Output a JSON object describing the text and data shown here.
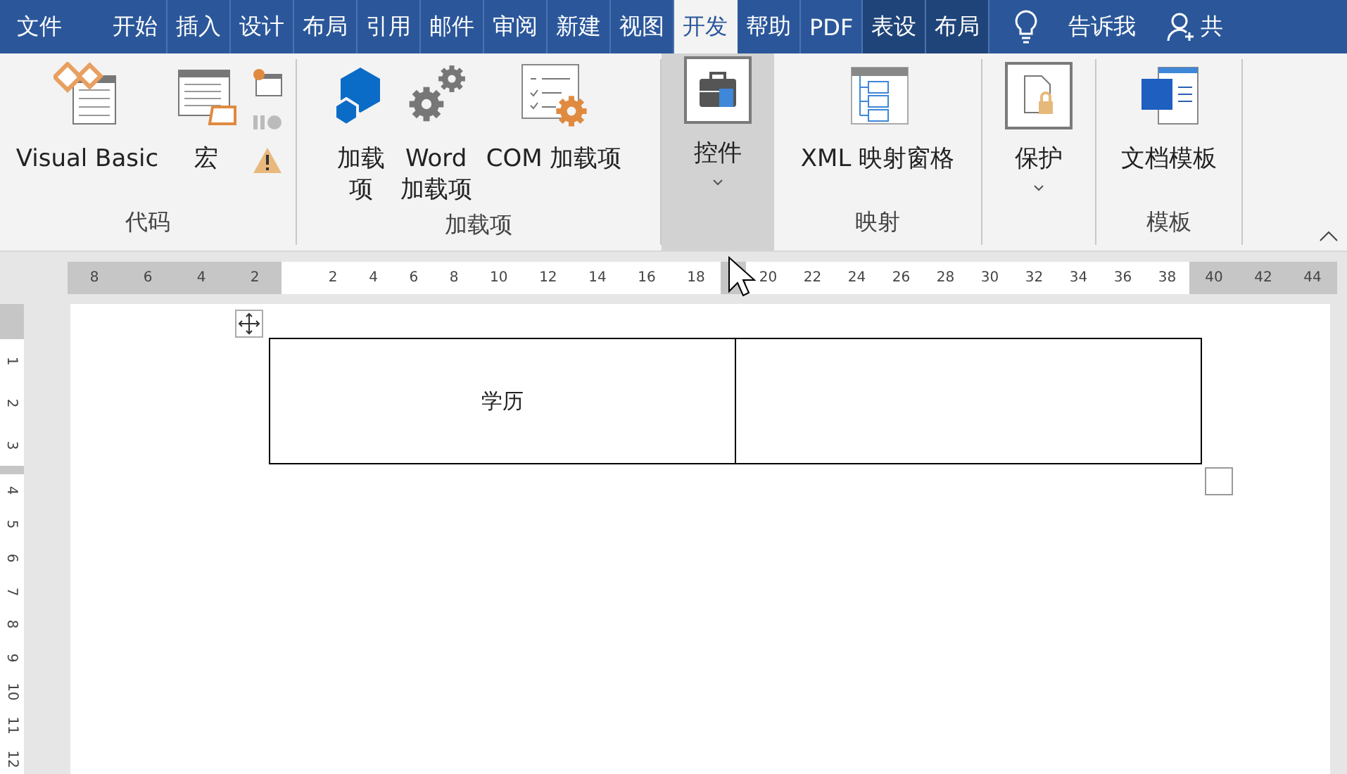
{
  "tabs": [
    {
      "label": "文件",
      "selected": false,
      "kind": "file"
    },
    {
      "label": "开始",
      "selected": false,
      "kind": "normal"
    },
    {
      "label": "插入",
      "selected": false,
      "kind": "normal"
    },
    {
      "label": "设计",
      "selected": false,
      "kind": "normal"
    },
    {
      "label": "布局",
      "selected": false,
      "kind": "normal"
    },
    {
      "label": "引用",
      "selected": false,
      "kind": "normal"
    },
    {
      "label": "邮件",
      "selected": false,
      "kind": "normal"
    },
    {
      "label": "审阅",
      "selected": false,
      "kind": "normal"
    },
    {
      "label": "新建",
      "selected": false,
      "kind": "normal"
    },
    {
      "label": "视图",
      "selected": false,
      "kind": "normal"
    },
    {
      "label": "开发",
      "selected": true,
      "kind": "normal"
    },
    {
      "label": "帮助",
      "selected": false,
      "kind": "normal"
    },
    {
      "label": "PDF",
      "selected": false,
      "kind": "normal"
    },
    {
      "label": "表设",
      "selected": false,
      "kind": "contextual"
    },
    {
      "label": "布局",
      "selected": false,
      "kind": "contextual"
    }
  ],
  "tell_me": "告诉我",
  "share": "共",
  "groups": [
    {
      "label": "代码",
      "buttons": [
        {
          "kind": "large",
          "label": "Visual Basic"
        },
        {
          "kind": "large",
          "label": "宏"
        },
        {
          "kind": "small_stack"
        }
      ]
    },
    {
      "label": "加载项",
      "buttons": [
        {
          "kind": "narrow",
          "label": "加载项"
        },
        {
          "kind": "large",
          "label": "Word\n加载项"
        },
        {
          "kind": "large",
          "label": "COM 加载项"
        }
      ]
    },
    {
      "pressed": true,
      "buttons": [
        {
          "kind": "dropdown",
          "label": "控件"
        }
      ]
    },
    {
      "label": "映射",
      "buttons": [
        {
          "kind": "large",
          "label": "XML 映射窗格"
        }
      ]
    },
    {
      "buttons": [
        {
          "kind": "dropdown",
          "label": "保护"
        }
      ]
    },
    {
      "label": "模板",
      "buttons": [
        {
          "kind": "large",
          "label": "文档模板"
        }
      ]
    }
  ],
  "ruler": [
    {
      "kind": "margin",
      "labels": [
        "8",
        "6",
        "4",
        "2"
      ]
    },
    {
      "kind": "text",
      "labels": [
        "2",
        "4",
        "6",
        "8",
        "10",
        "12",
        "14",
        "16",
        "18"
      ]
    },
    {
      "kind": "marker"
    },
    {
      "kind": "text",
      "labels": [
        "20",
        "22",
        "24",
        "26",
        "28",
        "30",
        "32",
        "34",
        "36",
        "38"
      ]
    },
    {
      "kind": "margin",
      "labels": [
        "40",
        "42",
        "44"
      ]
    }
  ],
  "vruler": [
    {
      "kind": "margin"
    },
    {
      "kind": "text",
      "labels": [
        "1",
        "2",
        "3"
      ]
    },
    {
      "kind": "margin"
    },
    {
      "kind": "text",
      "labels": [
        "4",
        "5",
        "6",
        "7",
        "8",
        "9",
        "10",
        "11",
        "12"
      ]
    }
  ],
  "table": {
    "rows": [
      [
        "学历",
        ""
      ]
    ]
  }
}
